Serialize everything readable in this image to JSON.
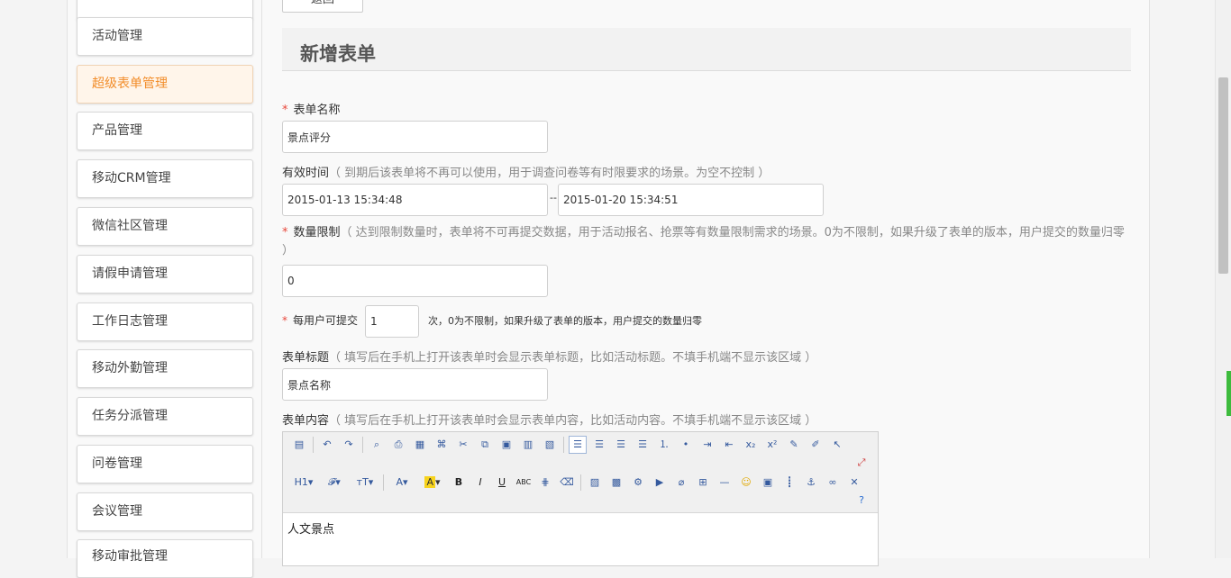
{
  "sidebar": {
    "items": [
      {
        "label": "活动管理",
        "active": false
      },
      {
        "label": "超级表单管理",
        "active": true
      },
      {
        "label": "产品管理",
        "active": false
      },
      {
        "label": "移动CRM管理",
        "active": false
      },
      {
        "label": "微信社区管理",
        "active": false
      },
      {
        "label": "请假申请管理",
        "active": false
      },
      {
        "label": "工作日志管理",
        "active": false
      },
      {
        "label": "移动外勤管理",
        "active": false
      },
      {
        "label": "任务分派管理",
        "active": false
      },
      {
        "label": "问卷管理",
        "active": false
      },
      {
        "label": "会议管理",
        "active": false
      },
      {
        "label": "移动审批管理",
        "active": false
      }
    ]
  },
  "main": {
    "back_label": "返回",
    "section_title": "新增表单",
    "form_name": {
      "label": "表单名称",
      "value": "景点评分"
    },
    "valid_time": {
      "label": "有效时间",
      "hint": "（ 到期后该表单将不再可以使用，用于调查问卷等有时限要求的场景。为空不控制 ）",
      "start": "2015-01-13 15:34:48",
      "separator": "--",
      "end": "2015-01-20 15:34:51"
    },
    "quantity_limit": {
      "label": "数量限制",
      "hint": "（ 达到限制数量时，表单将不可再提交数据，用于活动报名、抢票等有数量限制需求的场景。0为不限制，如果升级了表单的版本，用户提交的数量归零 ）",
      "value": "0"
    },
    "per_user": {
      "label": "每用户可提交",
      "value": "1",
      "suffix": "次，0为不限制，如果升级了表单的版本，用户提交的数量归零"
    },
    "form_title": {
      "label": "表单标题",
      "hint": "（ 填写后在手机上打开该表单时会显示表单标题，比如活动标题。不填手机端不显示该区域 ）",
      "value": "景点名称"
    },
    "form_content": {
      "label": "表单内容",
      "hint": "（ 填写后在手机上打开该表单时会显示表单内容，比如活动内容。不填手机端不显示该区域 ）",
      "body": "人文景点"
    }
  },
  "editor_toolbar": {
    "row1": [
      "source-icon",
      "undo-icon",
      "redo-icon",
      "preview-icon",
      "print-icon",
      "template-icon",
      "code-icon",
      "cut-icon",
      "copy-icon",
      "paste-icon",
      "paste-text-icon",
      "paste-word-icon",
      "align-left-icon",
      "align-center-icon",
      "align-right-icon",
      "justify-icon",
      "ordered-list-icon",
      "unordered-list-icon",
      "indent-icon",
      "outdent-icon",
      "subscript-icon",
      "superscript-icon",
      "clear-format-icon",
      "select-all-icon",
      "cursor-icon",
      "fullscreen-icon"
    ],
    "row2": [
      "heading-icon",
      "font-family-icon",
      "font-size-icon",
      "font-color-icon",
      "highlight-icon",
      "bold-icon",
      "italic-icon",
      "underline-icon",
      "strikethrough-icon",
      "line-height-icon",
      "remove-format-icon",
      "image-icon",
      "multi-image-icon",
      "flash-icon",
      "media-icon",
      "attach-icon",
      "table-icon",
      "hr-icon",
      "emoticon-icon",
      "map-icon",
      "pagebreak-icon",
      "anchor-icon",
      "link-icon",
      "unlink-icon",
      "help-icon"
    ]
  }
}
